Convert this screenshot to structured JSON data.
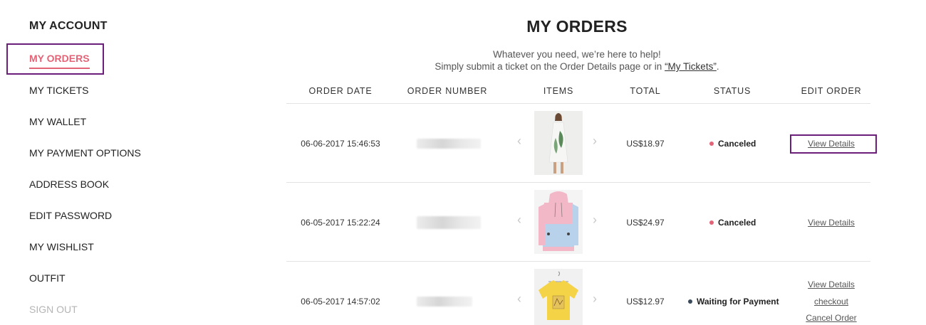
{
  "sidebar": {
    "title": "MY ACCOUNT",
    "items": [
      {
        "label": "MY ORDERS",
        "active": true
      },
      {
        "label": "MY TICKETS"
      },
      {
        "label": "MY WALLET"
      },
      {
        "label": "MY PAYMENT OPTIONS"
      },
      {
        "label": "ADDRESS BOOK"
      },
      {
        "label": "EDIT PASSWORD"
      },
      {
        "label": "MY WISHLIST"
      },
      {
        "label": "OUTFIT"
      },
      {
        "label": "SIGN OUT",
        "muted": true
      }
    ]
  },
  "main": {
    "title": "MY ORDERS",
    "help_line1": "Whatever you need, we’re here to help!",
    "help_line2_prefix": "Simply submit a ticket on the Order Details page or in ",
    "help_link": "“My Tickets”",
    "help_line2_suffix": "."
  },
  "table": {
    "headers": [
      "ORDER DATE",
      "ORDER NUMBER",
      "ITEMS",
      "TOTAL",
      "STATUS",
      "EDIT ORDER"
    ],
    "rows": [
      {
        "date": "06-06-2017 15:46:53",
        "total": "US$18.97",
        "status": "Canceled",
        "status_color": "#e36377",
        "item_icon": "white-dress-image",
        "actions": [
          "View Details"
        ]
      },
      {
        "date": "06-05-2017 15:22:24",
        "total": "US$24.97",
        "status": "Canceled",
        "status_color": "#e36377",
        "item_icon": "pink-blue-hoodie-image",
        "actions": [
          "View Details"
        ]
      },
      {
        "date": "06-05-2017 14:57:02",
        "total": "US$12.97",
        "status": "Waiting for Payment",
        "status_color": "#3a4a5c",
        "item_icon": "yellow-tshirt-image",
        "actions": [
          "View Details",
          "checkout",
          "Cancel Order"
        ]
      }
    ]
  },
  "colors": {
    "accent": "#e36377",
    "highlight": "#6b1f7a"
  }
}
